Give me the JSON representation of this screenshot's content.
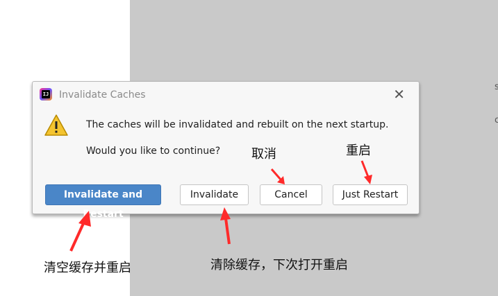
{
  "dialog": {
    "title": "Invalidate Caches",
    "close_glyph": "✕",
    "icon": "intellij-app-icon",
    "icon_text": "IJ",
    "warning_icon": "warning-triangle-icon",
    "message_line1": "The caches will be invalidated and rebuilt on the next startup.",
    "message_line2": "Would you like to continue?",
    "buttons": {
      "invalidate_restart": "Invalidate and Restart",
      "invalidate": "Invalidate",
      "cancel": "Cancel",
      "just_restart": "Just Restart"
    }
  },
  "annotations": {
    "cancel": "取消",
    "just_restart": "重启",
    "invalidate_restart": "清空缓存并重启",
    "invalidate": "清除缓存，下次打开重启"
  },
  "edge_text": [
    "s",
    "c"
  ],
  "colors": {
    "primary_button": "#4a86c8",
    "arrow": "#ff2a2a",
    "warning": "#f4c430"
  }
}
